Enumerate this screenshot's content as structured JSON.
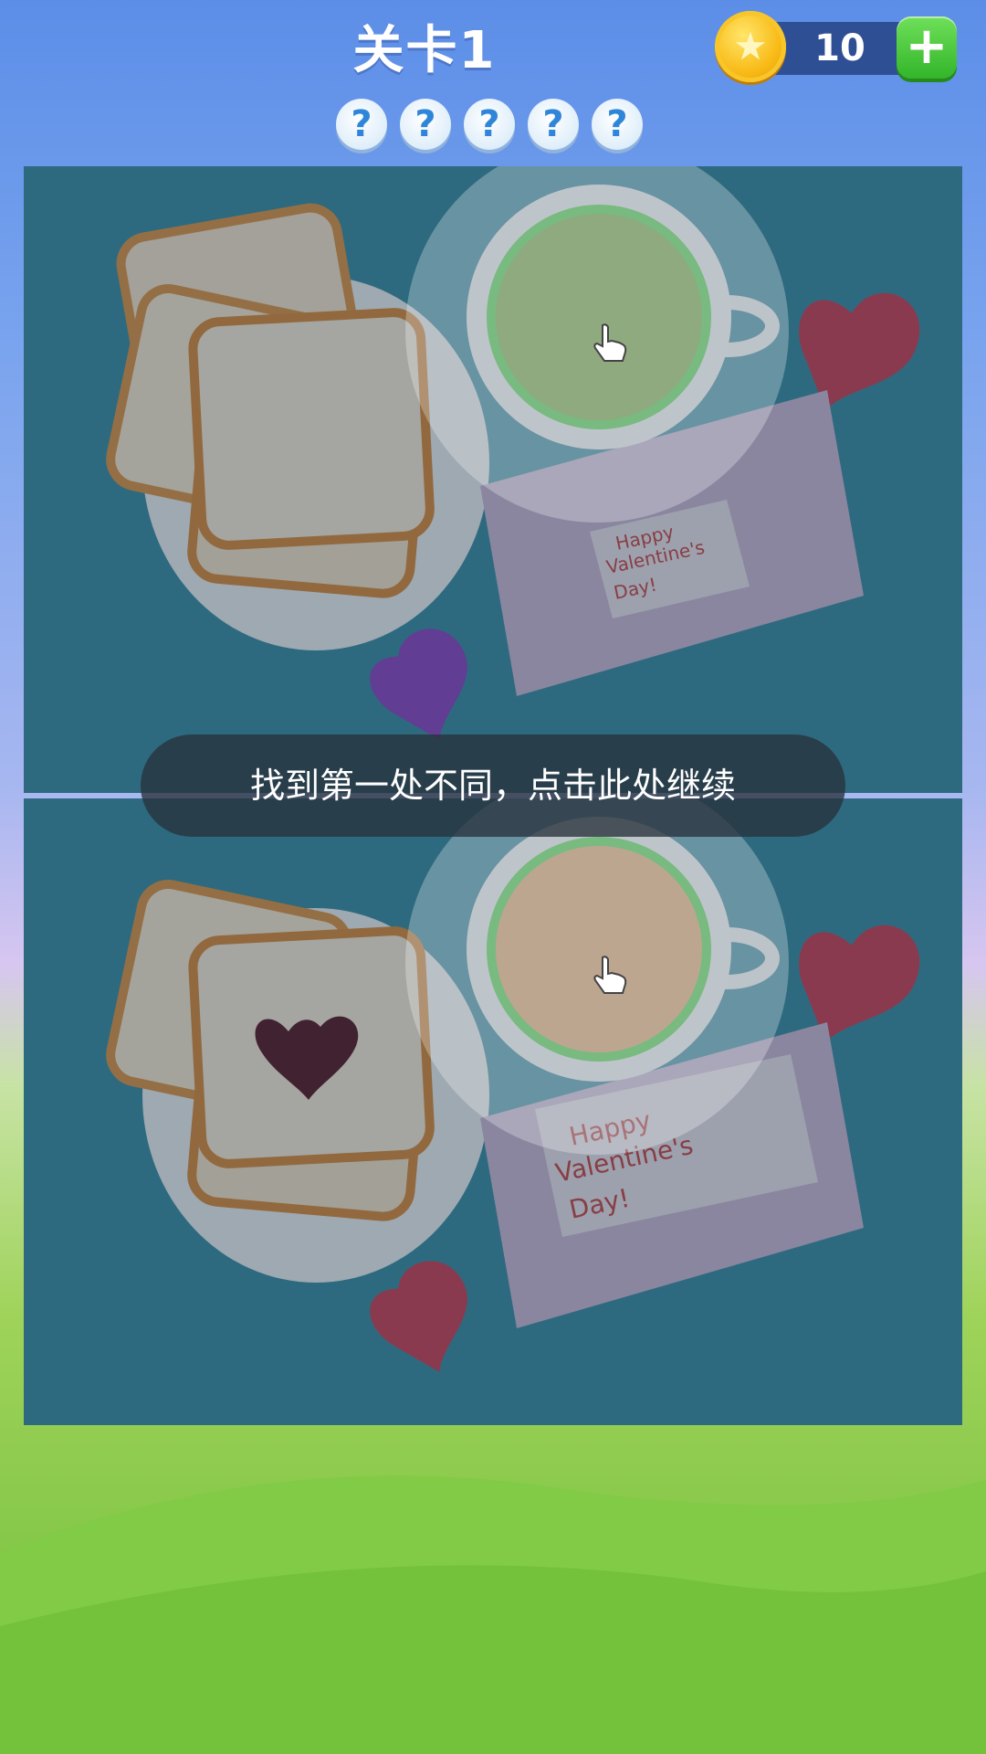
{
  "header": {
    "level_title": "关卡1",
    "coins": "10",
    "hint_slots": [
      "?",
      "?",
      "?",
      "?",
      "?"
    ]
  },
  "overlay": {
    "tip_text": "找到第一处不同，点击此处继续"
  },
  "card_text": {
    "line1": "Happy",
    "line2": "Valentine's",
    "line3": "Day!"
  },
  "colors": {
    "found_ring": "#5ee05a",
    "top_tea": "#8fbf58",
    "bottom_tea": "#f2b57c"
  }
}
